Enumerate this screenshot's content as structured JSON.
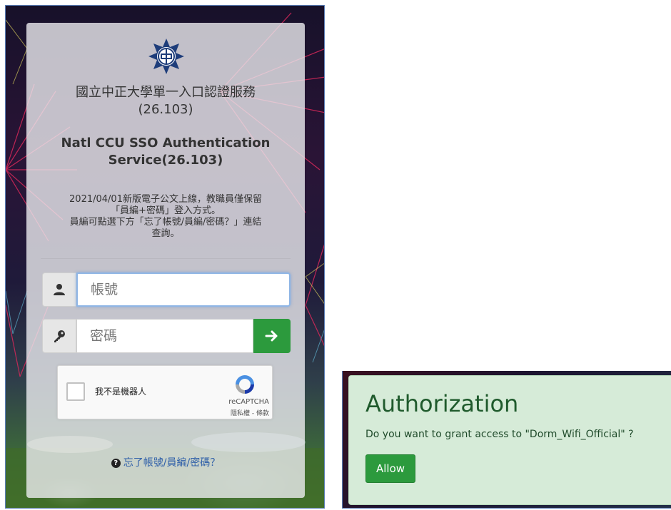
{
  "sso": {
    "title_zh": "國立中正大學單一入口認證服務",
    "version": "(26.103)",
    "title_en": "Natl CCU SSO Authentication Service(26.103)",
    "notice_line1": "2021/04/01新版電子公文上線，教職員僅保留",
    "notice_line2": "「員編+密碼」登入方式。",
    "notice_line3": "員編可點選下方「忘了帳號/員編/密碼？」連結",
    "notice_line4": "查詢。",
    "username_placeholder": "帳號",
    "password_placeholder": "密碼",
    "captcha_label": "我不是機器人",
    "captcha_brand": "reCAPTCHA",
    "captcha_links": "隱私權 - 條款",
    "forgot_link": "忘了帳號/員編/密碼？"
  },
  "auth": {
    "title": "Authorization",
    "message": "Do you want to grant access to \"Dorm_Wifi_Official\" ?",
    "allow_label": "Allow"
  },
  "colors": {
    "accent_green": "#2c9a3d",
    "link_blue": "#2d5ea8",
    "auth_panel": "#d6ebd8",
    "auth_title": "#1f5a2c"
  },
  "icons": [
    "university-logo-icon",
    "user-icon",
    "key-icon",
    "arrow-right-icon",
    "recaptcha-logo-icon",
    "question-circle-icon"
  ]
}
